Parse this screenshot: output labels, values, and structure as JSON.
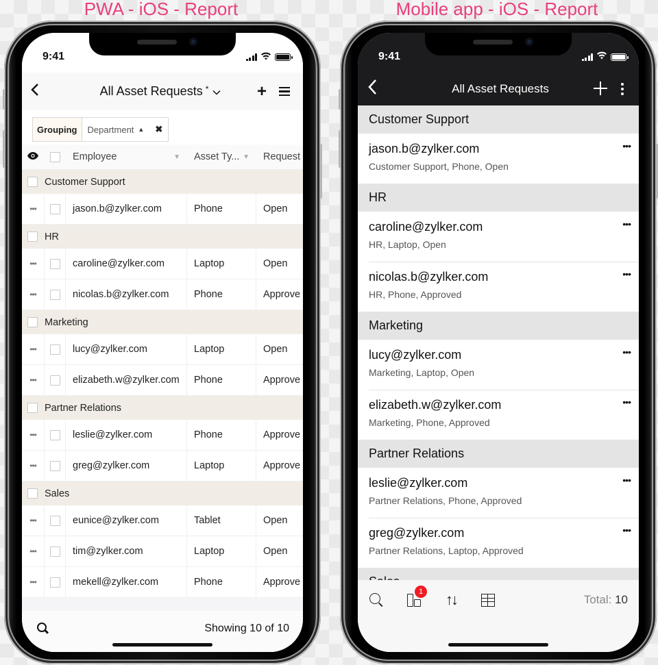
{
  "captions": {
    "left": "PWA - iOS - Report",
    "right": "Mobile app - iOS - Report"
  },
  "status_bar": {
    "time": "9:41"
  },
  "pwa": {
    "header": {
      "back_icon": "chevron-left-icon",
      "title": "All Asset Requests",
      "modified_marker": "*",
      "title_caret": "⌄",
      "add_label": "+",
      "menu_icon": "hamburger-icon"
    },
    "grouping": {
      "label": "Grouping",
      "field": "Department",
      "sort_icon": "▲",
      "remove_icon": "✖"
    },
    "columns": [
      {
        "label": "Employee",
        "sort_icon": "▼"
      },
      {
        "label": "Asset Ty...",
        "sort_icon": "▼"
      },
      {
        "label": "Request"
      }
    ],
    "groups": [
      {
        "name": "Customer Support",
        "rows": [
          {
            "employee": "jason.b@zylker.com",
            "asset_type": "Phone",
            "request": "Open"
          }
        ]
      },
      {
        "name": "HR",
        "rows": [
          {
            "employee": "caroline@zylker.com",
            "asset_type": "Laptop",
            "request": "Open"
          },
          {
            "employee": "nicolas.b@zylker.com",
            "asset_type": "Phone",
            "request": "Approve"
          }
        ]
      },
      {
        "name": "Marketing",
        "rows": [
          {
            "employee": "lucy@zylker.com",
            "asset_type": "Laptop",
            "request": "Open"
          },
          {
            "employee": "elizabeth.w@zylker.com",
            "asset_type": "Phone",
            "request": "Approve"
          }
        ]
      },
      {
        "name": "Partner Relations",
        "rows": [
          {
            "employee": "leslie@zylker.com",
            "asset_type": "Phone",
            "request": "Approve"
          },
          {
            "employee": "greg@zylker.com",
            "asset_type": "Laptop",
            "request": "Approve"
          }
        ]
      },
      {
        "name": "Sales",
        "rows": [
          {
            "employee": "eunice@zylker.com",
            "asset_type": "Tablet",
            "request": "Open"
          },
          {
            "employee": "tim@zylker.com",
            "asset_type": "Laptop",
            "request": "Open"
          },
          {
            "employee": "mekell@zylker.com",
            "asset_type": "Phone",
            "request": "Approve"
          }
        ]
      }
    ],
    "row_menu_label": "•••",
    "footer": {
      "showing": "Showing 10 of 10"
    }
  },
  "native": {
    "header": {
      "title": "All Asset Requests",
      "back_label": "‹",
      "add_label": "+"
    },
    "groups": [
      {
        "name": "Customer Support",
        "items": [
          {
            "email": "jason.b@zylker.com",
            "subtitle": "Customer Support, Phone, Open"
          }
        ]
      },
      {
        "name": "HR",
        "items": [
          {
            "email": "caroline@zylker.com",
            "subtitle": "HR, Laptop, Open"
          },
          {
            "email": "nicolas.b@zylker.com",
            "subtitle": "HR, Phone, Approved"
          }
        ]
      },
      {
        "name": "Marketing",
        "items": [
          {
            "email": "lucy@zylker.com",
            "subtitle": "Marketing, Laptop, Open"
          },
          {
            "email": "elizabeth.w@zylker.com",
            "subtitle": "Marketing, Phone, Approved"
          }
        ]
      },
      {
        "name": "Partner Relations",
        "items": [
          {
            "email": "leslie@zylker.com",
            "subtitle": "Partner Relations, Phone, Approved"
          },
          {
            "email": "greg@zylker.com",
            "subtitle": "Partner Relations, Laptop, Approved"
          }
        ]
      },
      {
        "name": "Sales",
        "items": []
      }
    ],
    "item_menu_label": "•••",
    "toolbar": {
      "grouping_badge": "1",
      "sort_label": "↑↓",
      "total_label": "Total:",
      "total_value": "10"
    }
  },
  "colors": {
    "caption": "#e8407e",
    "pwa_group_bg": "#f1ede6",
    "native_header_bg": "#1c1c1e",
    "native_group_bg": "#e4e4e4",
    "badge": "#ef1c24"
  }
}
